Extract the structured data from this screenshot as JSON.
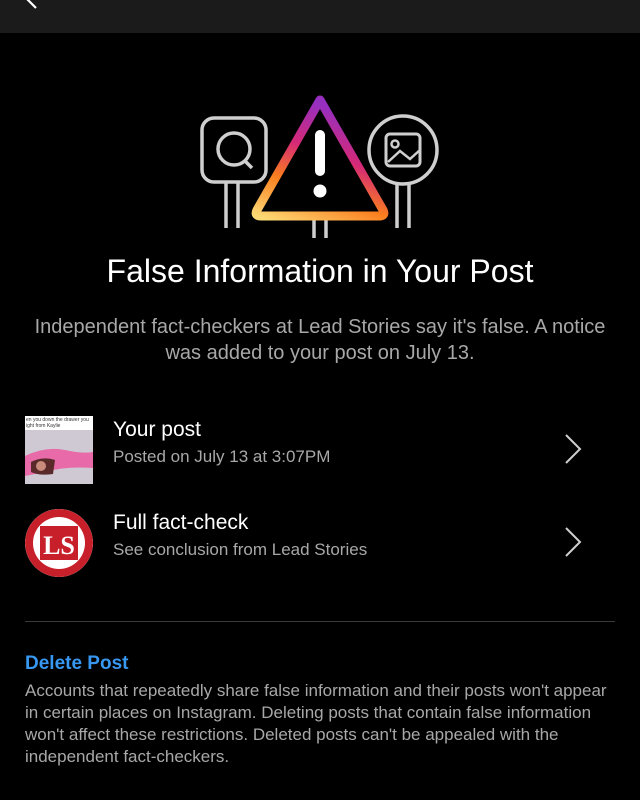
{
  "header": {
    "back_icon": "chevron-left-icon"
  },
  "hero": {
    "icons": [
      "chat-bubble-icon",
      "warning-triangle-icon",
      "image-icon"
    ],
    "gradient": [
      "#feda75",
      "#fa7e1e",
      "#d62976",
      "#962fbf",
      "#4f5bd5"
    ]
  },
  "notice": {
    "title": "False Information in Your Post",
    "description": "Independent fact-checkers at Lead Stories say it's false.  A notice was added to your post on July 13."
  },
  "rows": [
    {
      "title": "Your post",
      "subtitle": "Posted on July 13 at 3:07PM",
      "thumb_caption": "en you down the drawer you ight from Kaylie",
      "icon": "chevron-right-icon"
    },
    {
      "title": "Full fact-check",
      "subtitle": "See conclusion from Lead Stories",
      "logo_text": "LS",
      "icon": "chevron-right-icon"
    }
  ],
  "delete": {
    "title": "Delete Post",
    "body": "Accounts that repeatedly share false information and their posts won't appear in certain places on Instagram. Deleting posts that contain false information won't affect these restrictions. Deleted posts can't be appealed with the independent fact-checkers."
  },
  "colors": {
    "background": "#000000",
    "link": "#3897f0",
    "secondary_text": "#a8a8a8",
    "logo_red": "#c8202a"
  }
}
